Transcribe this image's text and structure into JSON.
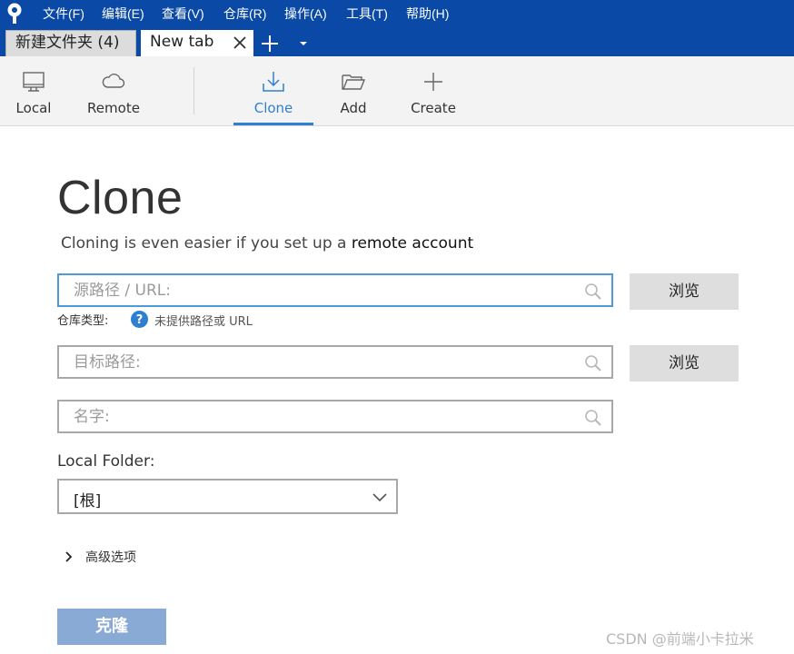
{
  "menubar": {
    "items": [
      "文件(F)",
      "编辑(E)",
      "查看(V)",
      "仓库(R)",
      "操作(A)",
      "工具(T)",
      "帮助(H)"
    ]
  },
  "tabs": [
    {
      "label": "新建文件夹 (4)",
      "active": false
    },
    {
      "label": "New tab",
      "active": true
    }
  ],
  "toolbar": {
    "local": "Local",
    "remote": "Remote",
    "clone": "Clone",
    "add": "Add",
    "create": "Create"
  },
  "main": {
    "title": "Clone",
    "subtitle_prefix": "Cloning is even easier if you set up a ",
    "subtitle_link": "remote account",
    "source_placeholder": "源路径 / URL:",
    "repo_type_label": "仓库类型:",
    "repo_type_msg": "未提供路径或 URL",
    "dest_placeholder": "目标路径:",
    "name_placeholder": "名字:",
    "browse_label": "浏览",
    "local_folder_label": "Local Folder:",
    "local_folder_value": "[根]",
    "advanced_label": "高级选项",
    "clone_button": "克隆"
  },
  "watermark": "CSDN @前端小卡拉米",
  "colors": {
    "menubar_bg": "#0a4aa6",
    "accent": "#2f7fd0",
    "clone_button_bg": "#8aaad6",
    "help_icon": "#2f7fd0"
  }
}
